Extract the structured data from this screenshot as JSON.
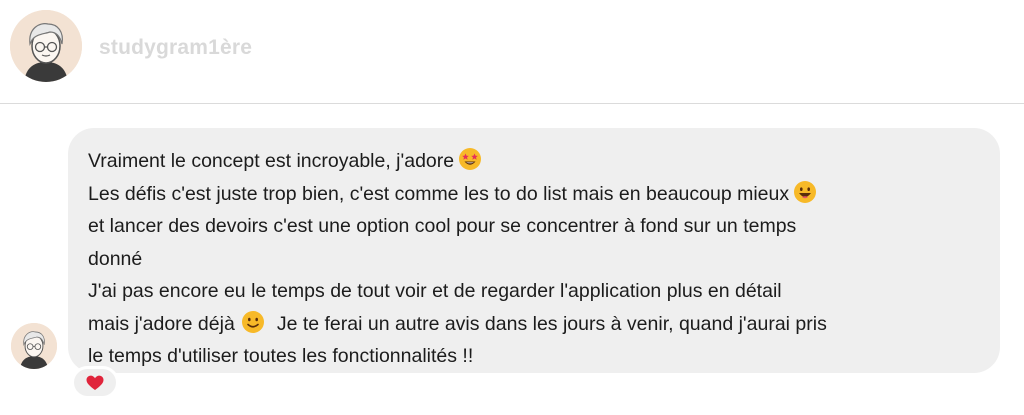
{
  "header": {
    "username": "studygram1ère",
    "avatar_icon": "user-avatar-icon"
  },
  "message": {
    "lines": [
      "Vraiment le concept est incroyable, j'adore",
      "Les défis c'est juste trop bien, c'est comme les to do list mais en beaucoup mieux",
      "et lancer des devoirs c'est une option cool pour se concentrer à fond sur un temps",
      "donné",
      "J'ai pas encore eu le temps de tout voir et de regarder l'application plus en détail",
      "mais j'adore déjà",
      "Je te ferai un autre avis dans les jours à venir, quand j'aurai pris",
      "le temps d'utiliser toutes les fonctionnalités !!"
    ],
    "emojis": [
      "star-struck-emoji",
      "grinning-emoji",
      "smiling-emoji"
    ]
  },
  "reaction": {
    "icon": "heart-icon",
    "color": "#e0243b"
  },
  "colors": {
    "bubble": "#efefef",
    "divider": "#dbdbdb",
    "username": "#d9d9d9"
  }
}
